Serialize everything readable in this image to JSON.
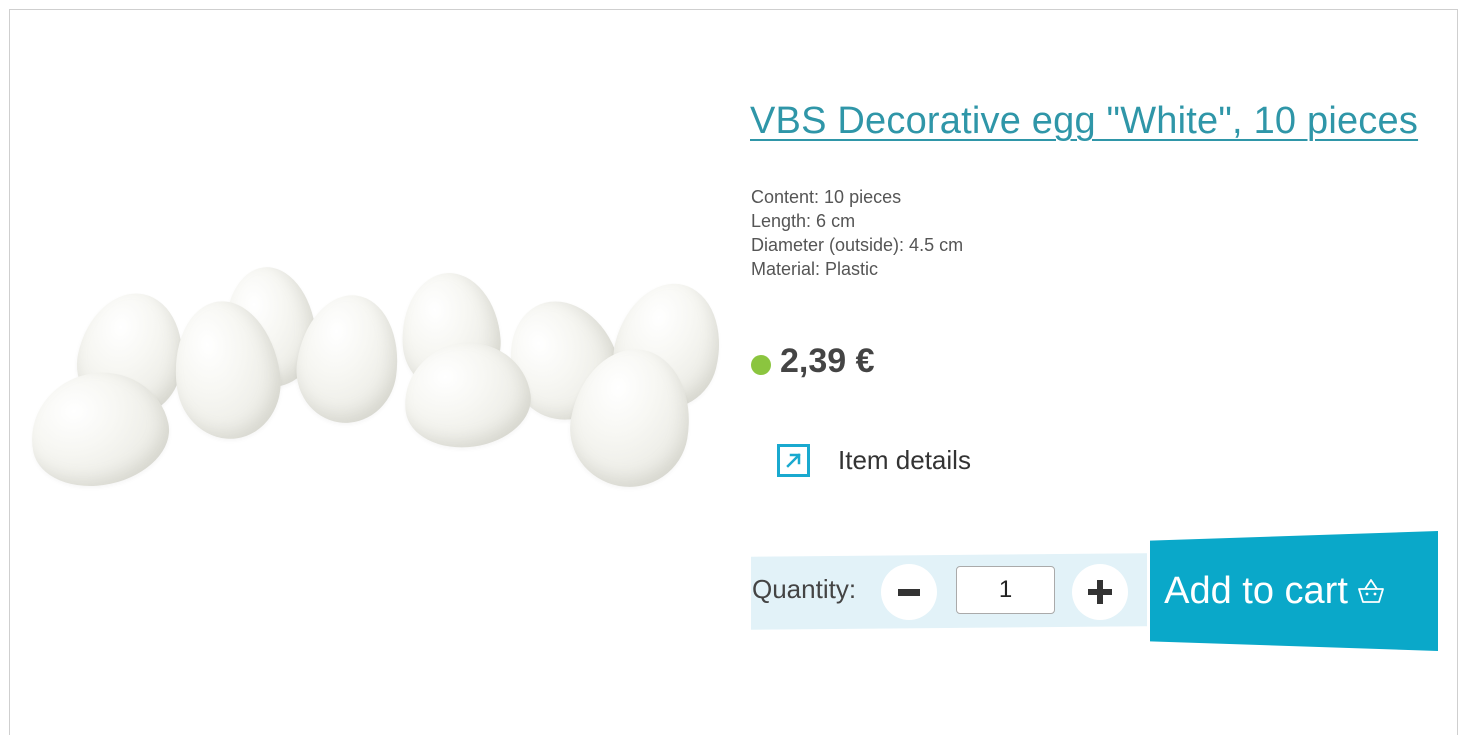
{
  "product": {
    "title": "VBS Decorative egg \"White\", 10 pieces",
    "image_alt": "White plastic decorative eggs",
    "specs": [
      "Content: 10 pieces",
      "Length: 6 cm",
      "Diameter (outside): 4.5 cm",
      "Material: Plastic"
    ],
    "price": "2,39 €",
    "stock_status_color": "#8bc53f"
  },
  "details_link": {
    "label": "Item details",
    "icon": "external-arrow-icon"
  },
  "quantity": {
    "label": "Quantity:",
    "value": "1",
    "decrease_icon": "minus-icon",
    "increase_icon": "plus-icon"
  },
  "cart_button": {
    "label": "Add to cart",
    "icon": "basket-icon"
  },
  "colors": {
    "accent": "#0aa8c9",
    "title_link": "#2f96a8",
    "quantity_panel": "#e2f2f8"
  }
}
